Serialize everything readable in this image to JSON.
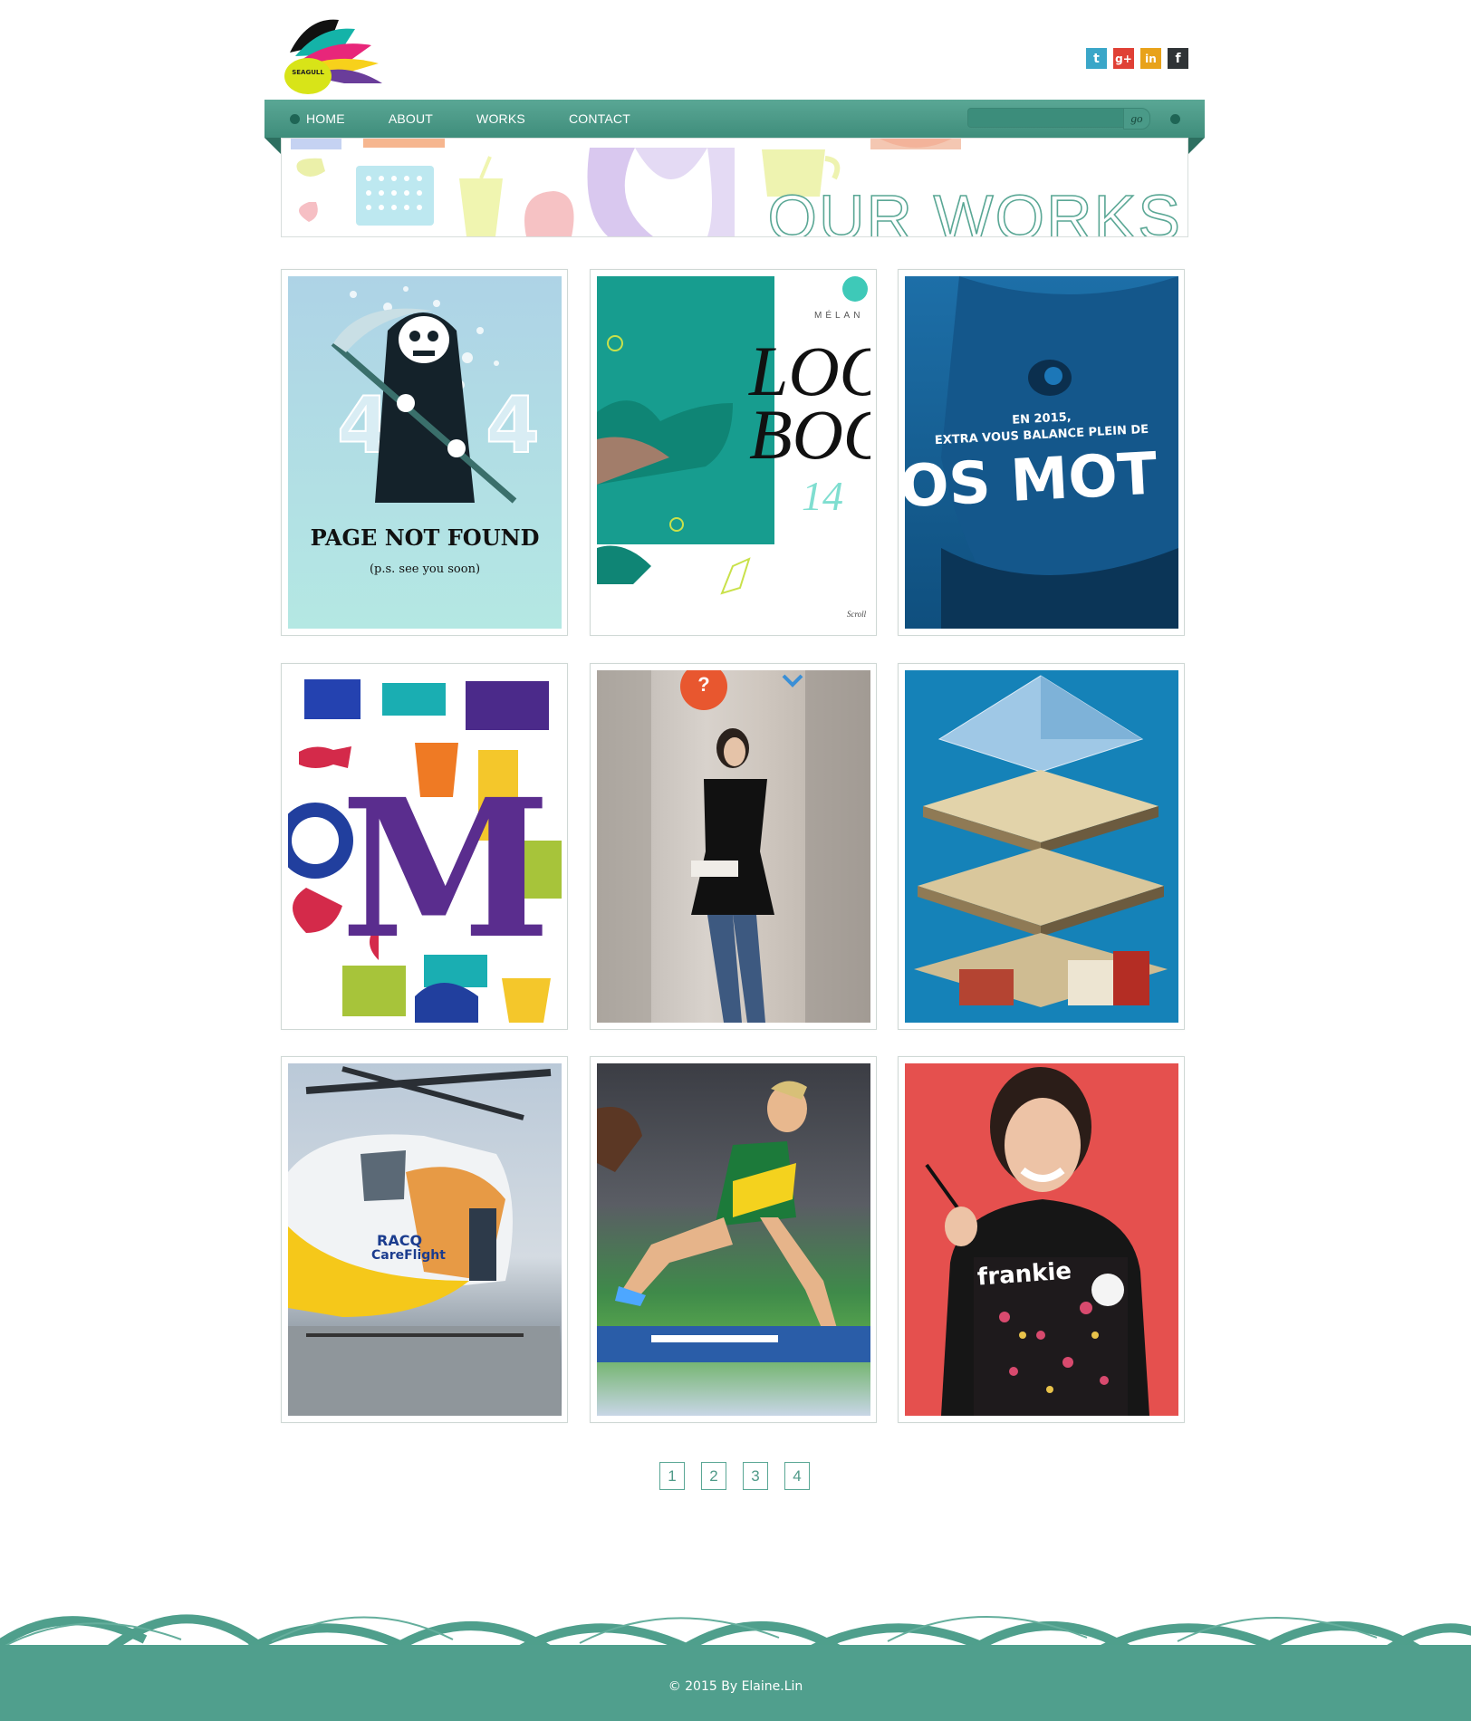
{
  "brand": {
    "logo_text": "SEAGULL"
  },
  "social": [
    {
      "name": "twitter-icon",
      "glyph": "t",
      "color": "#3aa6c8"
    },
    {
      "name": "google-plus-icon",
      "glyph": "g+",
      "color": "#e04035"
    },
    {
      "name": "linkedin-icon",
      "glyph": "in",
      "color": "#e8a21a"
    },
    {
      "name": "facebook-icon",
      "glyph": "f",
      "color": "#2f3336"
    }
  ],
  "nav": {
    "items": [
      "HOME",
      "ABOUT",
      "WORKS",
      "CONTACT"
    ],
    "search_placeholder": "",
    "search_button": "go"
  },
  "banner": {
    "title": "OUR WORKS"
  },
  "works": [
    {
      "label": "PAGE NOT FOUND",
      "sublabel": "(p.s. see you soon)",
      "digit": "4"
    },
    {
      "brand": "MÉLAN",
      "line1": "LOO",
      "line2": "BOO",
      "number": "14",
      "note": "Scroll"
    },
    {
      "line1": "EN 2015,",
      "line2": "EXTRA VOUS BALANCE PLEIN DE",
      "line3": "OS MOT"
    },
    {
      "letter": "M"
    },
    {
      "badge": "?"
    },
    {},
    {
      "line1": "RACQ",
      "line2": "CareFlight"
    },
    {},
    {
      "shirt": "frankie"
    }
  ],
  "pagination": [
    "1",
    "2",
    "3",
    "4"
  ],
  "footer": {
    "copyright": "© 2015 By Elaine.Lin"
  },
  "colors": {
    "accent": "#509f8d",
    "accent_dark": "#3f8d7b"
  }
}
